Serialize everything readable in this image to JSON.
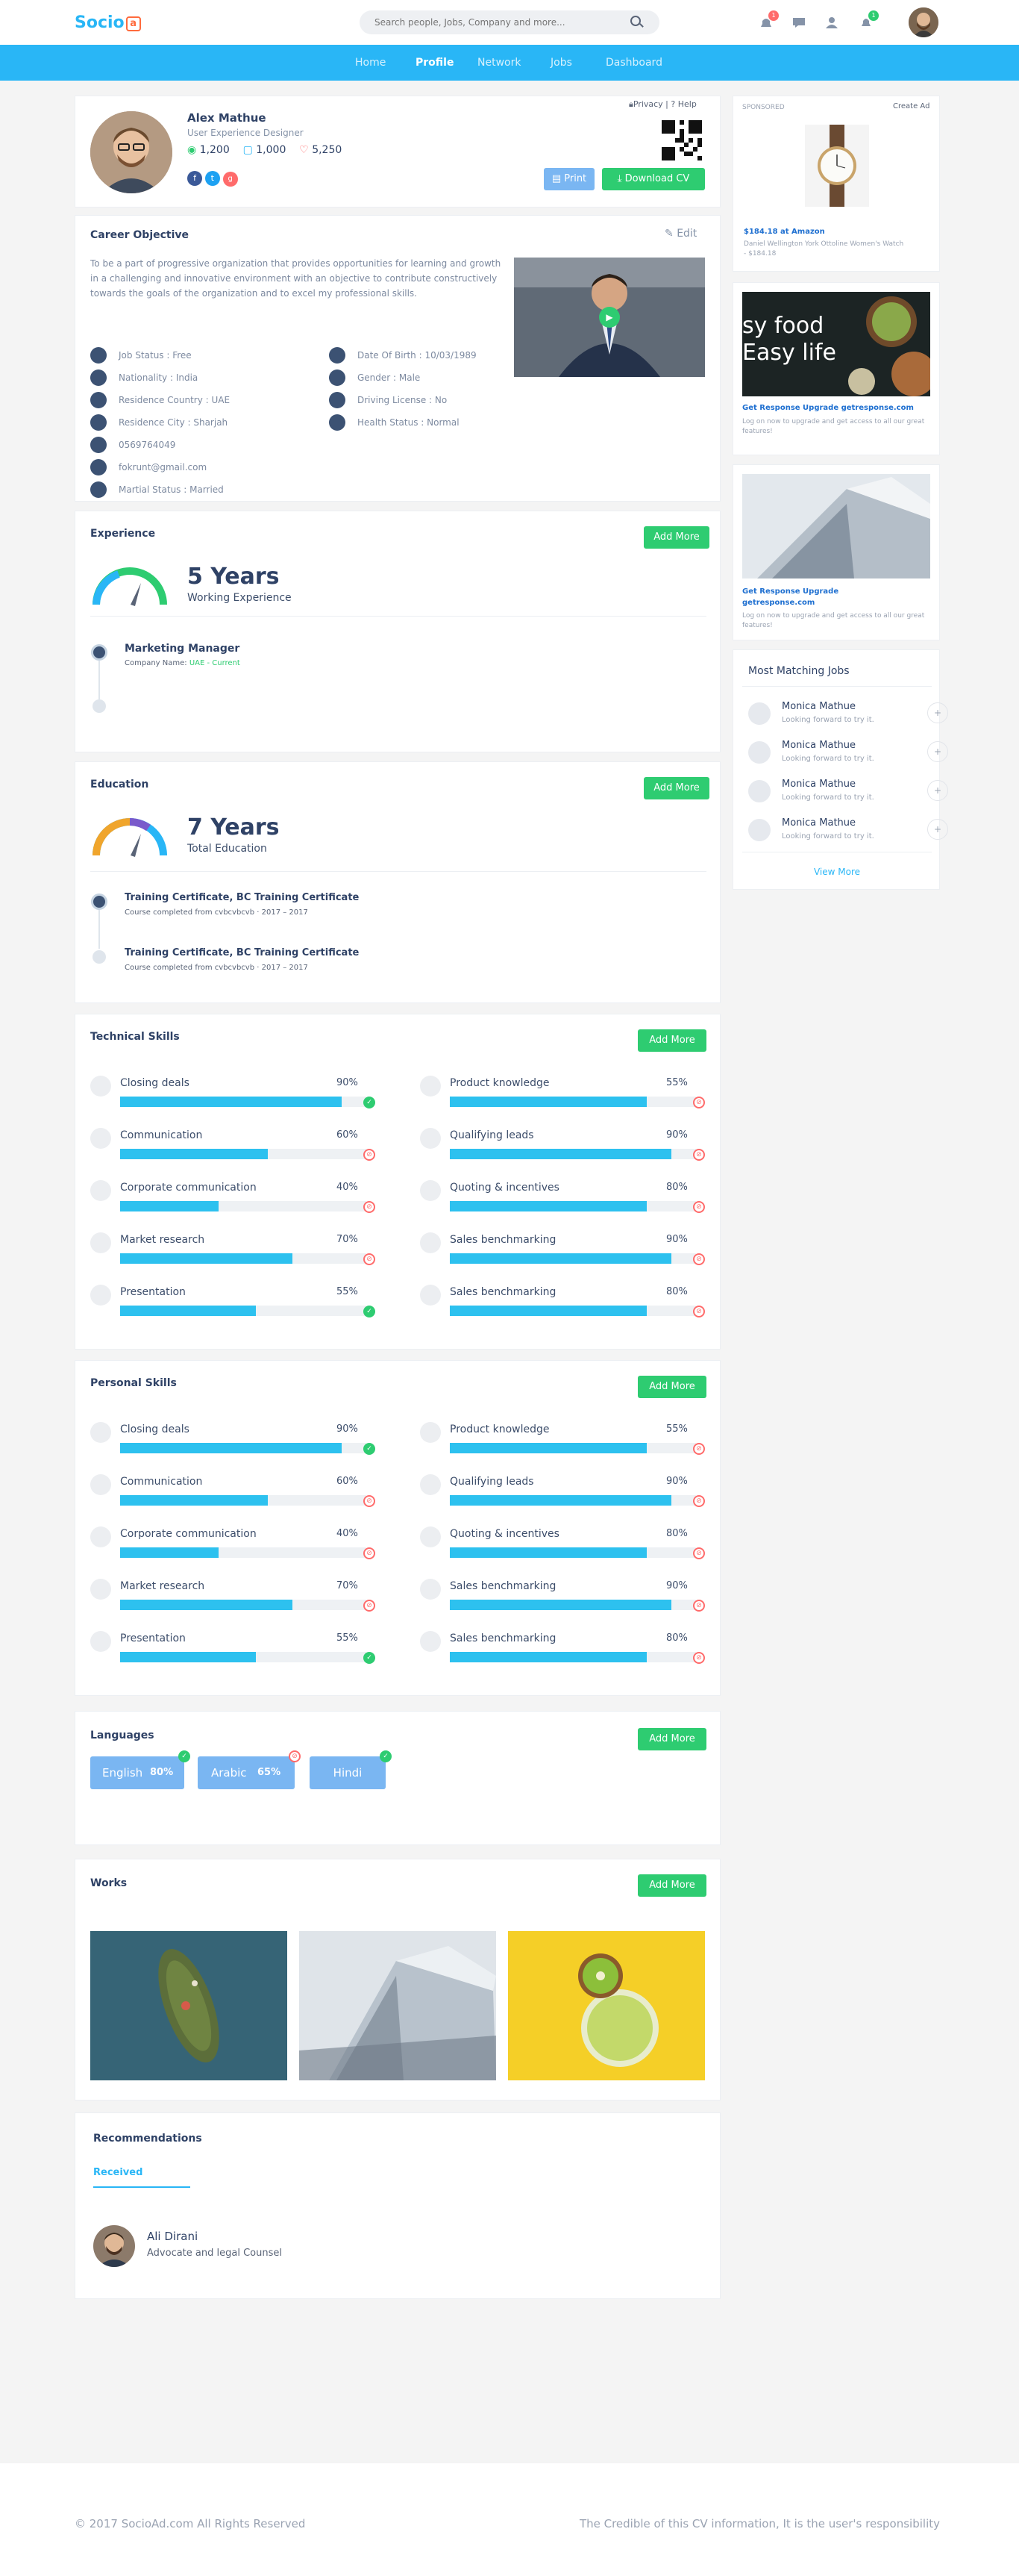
{
  "header": {
    "logo": "Socio",
    "logo_box": "a",
    "search_placeholder": "Search people, Jobs, Company and more...",
    "notif_count": "1",
    "msg_count": "1"
  },
  "nav": {
    "items": [
      "Home",
      "Profile",
      "Network",
      "Jobs",
      "Dashboard"
    ],
    "active": "Profile"
  },
  "profile": {
    "name": "Alex Mathue",
    "title": "User Experience Designer",
    "views": "1,200",
    "comments": "1,000",
    "likes": "5,250",
    "privacy": "Privacy",
    "help": "Help",
    "print": "Print",
    "download": "Download CV"
  },
  "career": {
    "title": "Career Objective",
    "edit": "Edit",
    "text": "To be a part of progressive organization that provides opportunities for learning and growth in a challenging and innovative environment with an objective to contribute constructively towards the goals of the organization and to excel my professional skills.",
    "left": [
      "Job Status : Free",
      "Nationality : India",
      "Residence Country : UAE",
      "Residence City : Sharjah",
      "0569764049",
      "fokrunt@gmail.com",
      "Martial Status : Married"
    ],
    "right": [
      "Date Of Birth : 10/03/1989",
      "Gender : Male",
      "Driving License : No",
      "Health Status : Normal"
    ]
  },
  "experience": {
    "title": "Experience",
    "add": "Add More",
    "years": "5 Years",
    "label": "Working Experience",
    "job_title": "Marketing Manager",
    "company_label": "Company Name:",
    "company": "UAE - Current"
  },
  "education": {
    "title": "Education",
    "add": "Add More",
    "years": "7 Years",
    "label": "Total Education",
    "items": [
      {
        "title": "Training Certificate, BC Training Certificate",
        "sub": "Course completed from cvbcvbcvb · 2017 – 2017"
      },
      {
        "title": "Training Certificate, BC Training Certificate",
        "sub": "Course completed from cvbcvbcvb · 2017 – 2017"
      }
    ]
  },
  "technical": {
    "title": "Technical Skills",
    "add": "Add More",
    "left": [
      {
        "name": "Closing deals",
        "pct": "90%",
        "v": 90,
        "ok": true
      },
      {
        "name": "Communication",
        "pct": "60%",
        "v": 60,
        "ok": false
      },
      {
        "name": "Corporate communication",
        "pct": "40%",
        "v": 40,
        "ok": false
      },
      {
        "name": "Market research",
        "pct": "70%",
        "v": 70,
        "ok": false
      },
      {
        "name": "Presentation",
        "pct": "55%",
        "v": 55,
        "ok": true
      }
    ],
    "right": [
      {
        "name": "Product knowledge",
        "pct": "55%",
        "v": 80,
        "ok": false
      },
      {
        "name": "Qualifying leads",
        "pct": "90%",
        "v": 90,
        "ok": false
      },
      {
        "name": "Quoting & incentives",
        "pct": "80%",
        "v": 80,
        "ok": false
      },
      {
        "name": "Sales benchmarking",
        "pct": "90%",
        "v": 90,
        "ok": false
      },
      {
        "name": "Sales benchmarking",
        "pct": "80%",
        "v": 80,
        "ok": false
      }
    ]
  },
  "personal": {
    "title": "Personal Skills",
    "add": "Add More",
    "left": [
      {
        "name": "Closing deals",
        "pct": "90%",
        "v": 90,
        "ok": true
      },
      {
        "name": "Communication",
        "pct": "60%",
        "v": 60,
        "ok": false
      },
      {
        "name": "Corporate communication",
        "pct": "40%",
        "v": 40,
        "ok": false
      },
      {
        "name": "Market research",
        "pct": "70%",
        "v": 70,
        "ok": false
      },
      {
        "name": "Presentation",
        "pct": "55%",
        "v": 55,
        "ok": true
      }
    ],
    "right": [
      {
        "name": "Product knowledge",
        "pct": "55%",
        "v": 80,
        "ok": false
      },
      {
        "name": "Qualifying leads",
        "pct": "90%",
        "v": 90,
        "ok": false
      },
      {
        "name": "Quoting & incentives",
        "pct": "80%",
        "v": 80,
        "ok": false
      },
      {
        "name": "Sales benchmarking",
        "pct": "90%",
        "v": 90,
        "ok": false
      },
      {
        "name": "Sales benchmarking",
        "pct": "80%",
        "v": 80,
        "ok": false
      }
    ]
  },
  "languages": {
    "title": "Languages",
    "add": "Add More",
    "items": [
      {
        "name": "English",
        "pct": "80%"
      },
      {
        "name": "Arabic",
        "pct": "65%"
      },
      {
        "name": "Hindi",
        "pct": ""
      }
    ]
  },
  "works": {
    "title": "Works",
    "add": "Add More"
  },
  "recommendations": {
    "title": "Recommendations",
    "tab": "Received",
    "name": "Ali Dirani",
    "role": "Advocate and legal Counsel"
  },
  "sidebar": {
    "sponsored": "SPONSORED",
    "create_ad": "Create Ad",
    "ad1_title": "$184.18 at Amazon",
    "ad1_desc": "Daniel Wellington York Ottoline Women's Watch - $184.18",
    "ad2_text": "sy food Easy life",
    "ad2_title": "Get Response Upgrade getresponse.com",
    "ad2_desc": "Log on now to upgrade and get access to all our great features!",
    "ad3_title": "Get Response Upgrade getresponse.com",
    "ad3_desc": "Log on now to upgrade and get access to all our great features!",
    "jobs_title": "Most Matching Jobs",
    "jobs": [
      {
        "name": "Monica Mathue",
        "sub": "Looking forward to try it."
      },
      {
        "name": "Monica Mathue",
        "sub": "Looking forward to try it."
      },
      {
        "name": "Monica Mathue",
        "sub": "Looking forward to try it."
      },
      {
        "name": "Monica Mathue",
        "sub": "Looking forward to try it."
      }
    ],
    "view_more": "View More"
  },
  "footer": {
    "left": "© 2017 SocioAd.com All Rights Reserved",
    "right": "The Credible of this CV information, It is the user's responsibility"
  }
}
